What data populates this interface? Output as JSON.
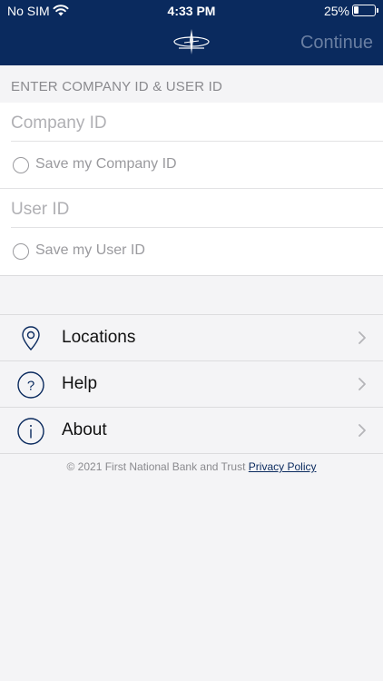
{
  "status_bar": {
    "carrier": "No SIM",
    "time": "4:33 PM",
    "battery_percent": "25%",
    "battery_level": 0.25
  },
  "header": {
    "continue_label": "Continue",
    "logo_icon": "first-national-bank-logo"
  },
  "form": {
    "section_label": "ENTER COMPANY ID & USER ID",
    "company_id_placeholder": "Company ID",
    "save_company_label": "Save my Company ID",
    "user_id_placeholder": "User ID",
    "save_user_label": "Save my User ID"
  },
  "menu": {
    "items": [
      {
        "label": "Locations",
        "icon": "location-pin-icon"
      },
      {
        "label": "Help",
        "icon": "question-circle-icon"
      },
      {
        "label": "About",
        "icon": "info-circle-icon"
      }
    ]
  },
  "footer": {
    "copyright": "© 2021 First National Bank and Trust",
    "privacy_link": "Privacy Policy"
  },
  "colors": {
    "header_bg": "#0a2a5e",
    "continue_text": "#6a7fa2",
    "page_bg": "#f4f4f6"
  }
}
